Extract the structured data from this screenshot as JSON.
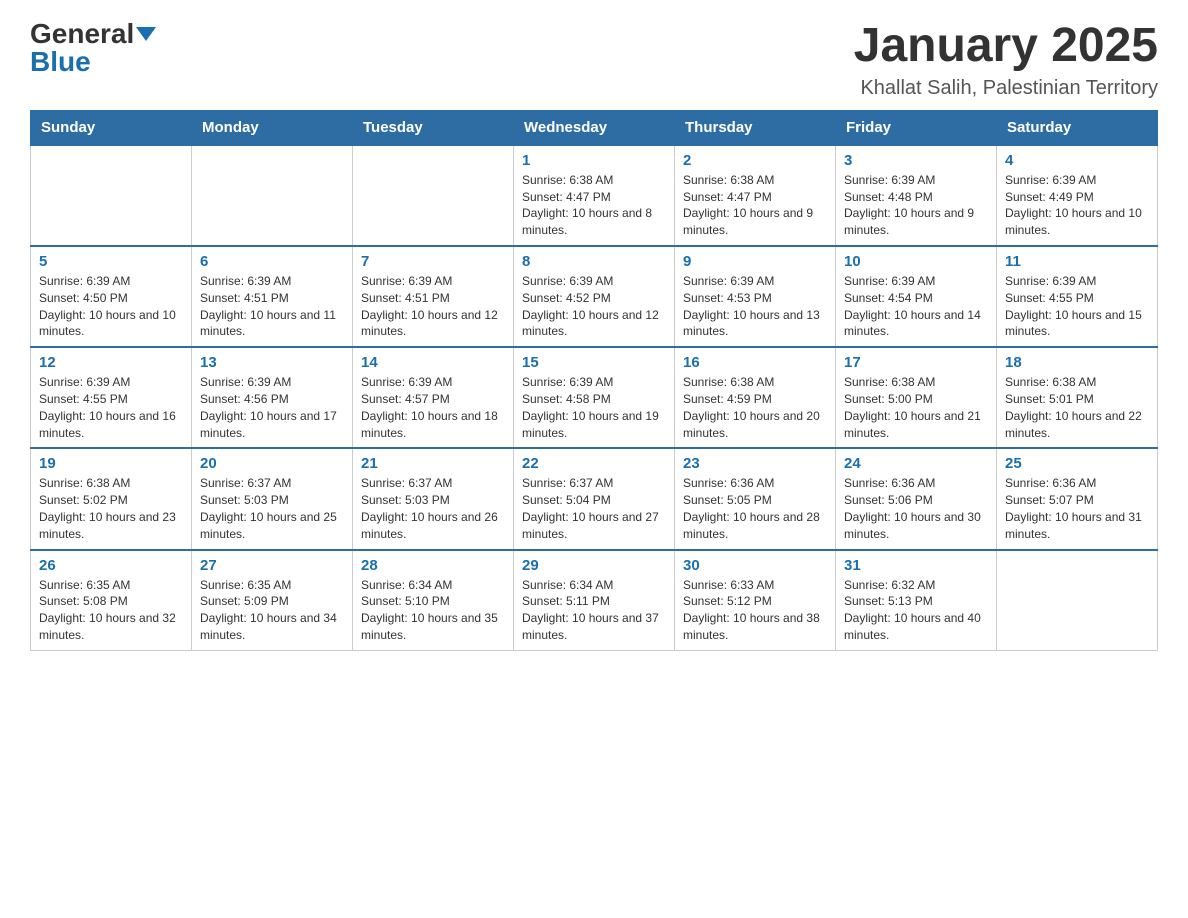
{
  "header": {
    "logo_general": "General",
    "logo_blue": "Blue",
    "month_title": "January 2025",
    "location": "Khallat Salih, Palestinian Territory"
  },
  "weekdays": [
    "Sunday",
    "Monday",
    "Tuesday",
    "Wednesday",
    "Thursday",
    "Friday",
    "Saturday"
  ],
  "weeks": [
    [
      {
        "day": "",
        "info": ""
      },
      {
        "day": "",
        "info": ""
      },
      {
        "day": "",
        "info": ""
      },
      {
        "day": "1",
        "info": "Sunrise: 6:38 AM\nSunset: 4:47 PM\nDaylight: 10 hours and 8 minutes."
      },
      {
        "day": "2",
        "info": "Sunrise: 6:38 AM\nSunset: 4:47 PM\nDaylight: 10 hours and 9 minutes."
      },
      {
        "day": "3",
        "info": "Sunrise: 6:39 AM\nSunset: 4:48 PM\nDaylight: 10 hours and 9 minutes."
      },
      {
        "day": "4",
        "info": "Sunrise: 6:39 AM\nSunset: 4:49 PM\nDaylight: 10 hours and 10 minutes."
      }
    ],
    [
      {
        "day": "5",
        "info": "Sunrise: 6:39 AM\nSunset: 4:50 PM\nDaylight: 10 hours and 10 minutes."
      },
      {
        "day": "6",
        "info": "Sunrise: 6:39 AM\nSunset: 4:51 PM\nDaylight: 10 hours and 11 minutes."
      },
      {
        "day": "7",
        "info": "Sunrise: 6:39 AM\nSunset: 4:51 PM\nDaylight: 10 hours and 12 minutes."
      },
      {
        "day": "8",
        "info": "Sunrise: 6:39 AM\nSunset: 4:52 PM\nDaylight: 10 hours and 12 minutes."
      },
      {
        "day": "9",
        "info": "Sunrise: 6:39 AM\nSunset: 4:53 PM\nDaylight: 10 hours and 13 minutes."
      },
      {
        "day": "10",
        "info": "Sunrise: 6:39 AM\nSunset: 4:54 PM\nDaylight: 10 hours and 14 minutes."
      },
      {
        "day": "11",
        "info": "Sunrise: 6:39 AM\nSunset: 4:55 PM\nDaylight: 10 hours and 15 minutes."
      }
    ],
    [
      {
        "day": "12",
        "info": "Sunrise: 6:39 AM\nSunset: 4:55 PM\nDaylight: 10 hours and 16 minutes."
      },
      {
        "day": "13",
        "info": "Sunrise: 6:39 AM\nSunset: 4:56 PM\nDaylight: 10 hours and 17 minutes."
      },
      {
        "day": "14",
        "info": "Sunrise: 6:39 AM\nSunset: 4:57 PM\nDaylight: 10 hours and 18 minutes."
      },
      {
        "day": "15",
        "info": "Sunrise: 6:39 AM\nSunset: 4:58 PM\nDaylight: 10 hours and 19 minutes."
      },
      {
        "day": "16",
        "info": "Sunrise: 6:38 AM\nSunset: 4:59 PM\nDaylight: 10 hours and 20 minutes."
      },
      {
        "day": "17",
        "info": "Sunrise: 6:38 AM\nSunset: 5:00 PM\nDaylight: 10 hours and 21 minutes."
      },
      {
        "day": "18",
        "info": "Sunrise: 6:38 AM\nSunset: 5:01 PM\nDaylight: 10 hours and 22 minutes."
      }
    ],
    [
      {
        "day": "19",
        "info": "Sunrise: 6:38 AM\nSunset: 5:02 PM\nDaylight: 10 hours and 23 minutes."
      },
      {
        "day": "20",
        "info": "Sunrise: 6:37 AM\nSunset: 5:03 PM\nDaylight: 10 hours and 25 minutes."
      },
      {
        "day": "21",
        "info": "Sunrise: 6:37 AM\nSunset: 5:03 PM\nDaylight: 10 hours and 26 minutes."
      },
      {
        "day": "22",
        "info": "Sunrise: 6:37 AM\nSunset: 5:04 PM\nDaylight: 10 hours and 27 minutes."
      },
      {
        "day": "23",
        "info": "Sunrise: 6:36 AM\nSunset: 5:05 PM\nDaylight: 10 hours and 28 minutes."
      },
      {
        "day": "24",
        "info": "Sunrise: 6:36 AM\nSunset: 5:06 PM\nDaylight: 10 hours and 30 minutes."
      },
      {
        "day": "25",
        "info": "Sunrise: 6:36 AM\nSunset: 5:07 PM\nDaylight: 10 hours and 31 minutes."
      }
    ],
    [
      {
        "day": "26",
        "info": "Sunrise: 6:35 AM\nSunset: 5:08 PM\nDaylight: 10 hours and 32 minutes."
      },
      {
        "day": "27",
        "info": "Sunrise: 6:35 AM\nSunset: 5:09 PM\nDaylight: 10 hours and 34 minutes."
      },
      {
        "day": "28",
        "info": "Sunrise: 6:34 AM\nSunset: 5:10 PM\nDaylight: 10 hours and 35 minutes."
      },
      {
        "day": "29",
        "info": "Sunrise: 6:34 AM\nSunset: 5:11 PM\nDaylight: 10 hours and 37 minutes."
      },
      {
        "day": "30",
        "info": "Sunrise: 6:33 AM\nSunset: 5:12 PM\nDaylight: 10 hours and 38 minutes."
      },
      {
        "day": "31",
        "info": "Sunrise: 6:32 AM\nSunset: 5:13 PM\nDaylight: 10 hours and 40 minutes."
      },
      {
        "day": "",
        "info": ""
      }
    ]
  ]
}
